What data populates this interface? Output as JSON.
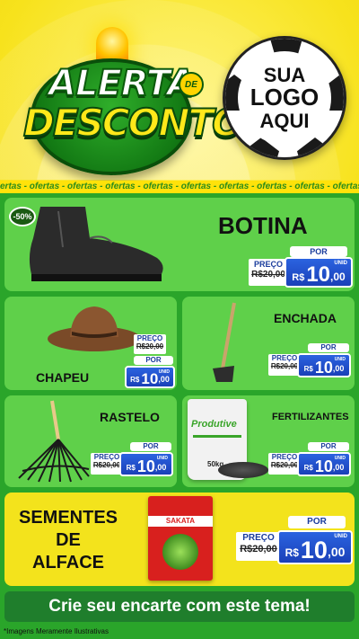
{
  "header": {
    "title_line1": "ALERTA",
    "title_de": "DE",
    "title_line2": "DESCONTO",
    "logo_line1": "SUA",
    "logo_line2": "LOGO",
    "logo_line3": "AQUI"
  },
  "ticker": {
    "text": "ertas - ofertas - ofertas - ofertas - ofertas - ofertas - ofertas - ofertas - ofertas - ofertas"
  },
  "products": {
    "botina": {
      "name": "BOTINA",
      "discount": "-50%",
      "por": "POR",
      "preco_label": "PREÇO",
      "old_price": "R$20,00",
      "currency": "R$",
      "price_int": "10",
      "price_dec": ",00",
      "unid": "UNID"
    },
    "chapeu": {
      "name": "CHAPEU",
      "por": "POR",
      "preco_label": "PREÇO",
      "old_price": "R$20,00",
      "currency": "R$",
      "price_int": "10",
      "price_dec": ",00",
      "unid": "UNID"
    },
    "enchada": {
      "name": "ENCHADA",
      "por": "POR",
      "preco_label": "PREÇO",
      "old_price": "R$20,00",
      "currency": "R$",
      "price_int": "10",
      "price_dec": ",00",
      "unid": "UNID"
    },
    "rastelo": {
      "name": "RASTELO",
      "por": "POR",
      "preco_label": "PREÇO",
      "old_price": "R$20,00",
      "currency": "R$",
      "price_int": "10",
      "price_dec": ",00",
      "unid": "UNID"
    },
    "fertilizantes": {
      "name": "FERTILIZANTES",
      "bag_brand": "Produtive",
      "bag_weight": "50kg",
      "por": "POR",
      "preco_label": "PREÇO",
      "old_price": "R$20,00",
      "currency": "R$",
      "price_int": "10",
      "price_dec": ",00",
      "unid": "UNID"
    },
    "sementes": {
      "name_line1": "SEMENTES",
      "name_line2": "DE",
      "name_line3": "ALFACE",
      "pack_brand": "SAKATA",
      "por": "POR",
      "preco_label": "PREÇO",
      "old_price": "R$20,00",
      "currency": "R$",
      "price_int": "10",
      "price_dec": ",00",
      "unid": "UNID"
    }
  },
  "footer": {
    "cta": "Crie seu encarte com este tema!",
    "note": "*Imagens Meramente Ilustrativas"
  },
  "colors": {
    "brand_green": "#1f7e2c",
    "price_blue": "#1a40b8",
    "card_green": "#5fd04a",
    "card_yellow": "#f3e31c"
  }
}
